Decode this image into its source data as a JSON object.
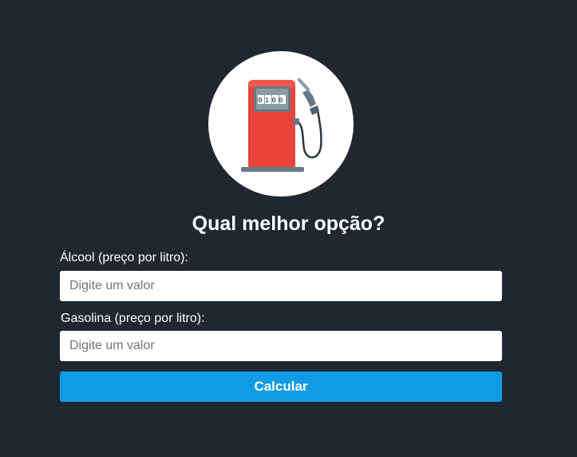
{
  "header": {
    "logo_icon": "fuel-pump-icon",
    "pump_display": "0100",
    "title": "Qual melhor opção?"
  },
  "form": {
    "alcool": {
      "label": "Álcool (preço por litro):",
      "placeholder": "Digite um valor",
      "value": ""
    },
    "gasolina": {
      "label": "Gasolina (preço por litro):",
      "placeholder": "Digite um valor",
      "value": ""
    },
    "submit_label": "Calcular"
  },
  "colors": {
    "background": "#212731",
    "button": "#119be6",
    "pump_body": "#e8443a",
    "pump_base": "#687a87"
  }
}
